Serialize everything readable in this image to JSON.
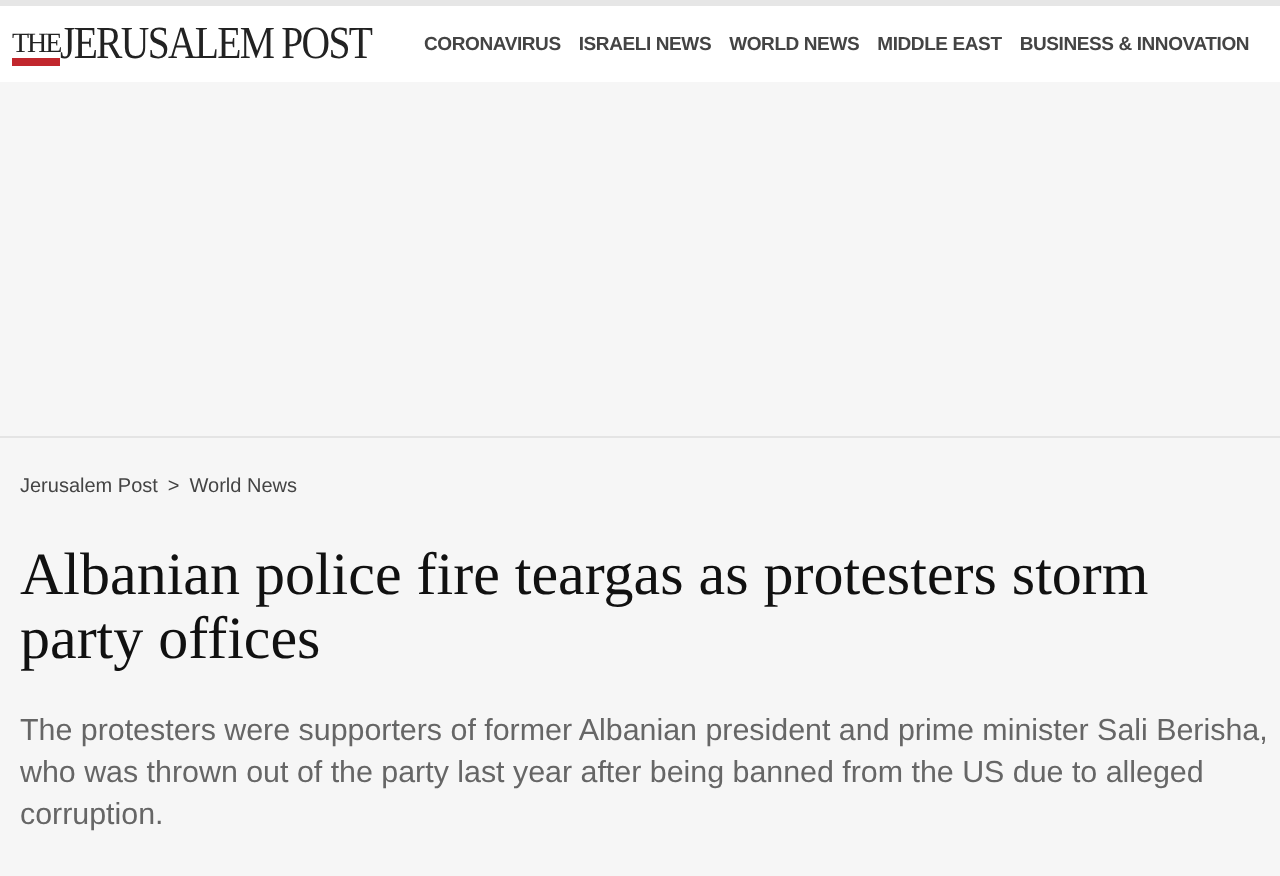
{
  "logo": {
    "prefix": "THE",
    "name": "JERUSALEM POST"
  },
  "nav": [
    "CORONAVIRUS",
    "ISRAELI NEWS",
    "WORLD NEWS",
    "MIDDLE EAST",
    "BUSINESS & INNOVATION"
  ],
  "breadcrumb": {
    "items": [
      "Jerusalem Post",
      "World News"
    ],
    "separator": ">"
  },
  "article": {
    "headline": "Albanian police fire teargas as protesters storm party offices",
    "summary": "The protesters were supporters of former Albanian president and prime minister Sali Berisha, who was thrown out of the party last year after being banned from the US due to alleged corruption."
  }
}
